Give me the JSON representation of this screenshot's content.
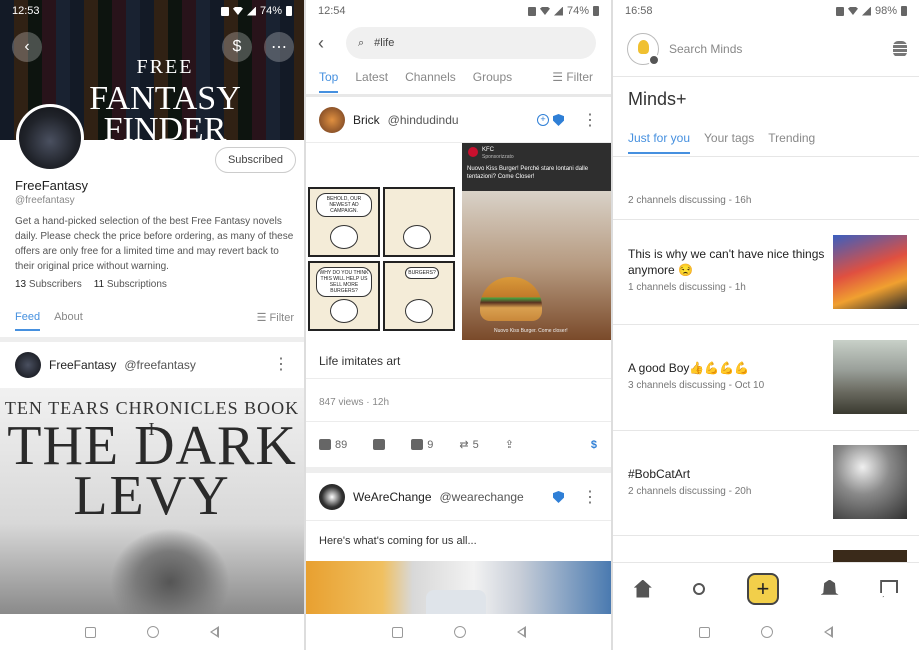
{
  "colors": {
    "accent": "#4690df",
    "verified": "#2f7fd6",
    "divider": "#eeeeee"
  },
  "phone1": {
    "status": {
      "time": "12:53",
      "battery": "74%"
    },
    "banner": {
      "line1": "FREE",
      "line2": "FANTASY",
      "line3": "FINDER"
    },
    "header_buttons": [
      "back-icon",
      "dollar-icon",
      "more-icon"
    ],
    "header_dollar": "$",
    "subscribe_label": "Subscribed",
    "channel": {
      "name": "FreeFantasy",
      "handle": "@freefantasy",
      "bio": "Get a hand-picked selection of the best Free Fantasy novels daily. Please check the price before ordering, as many of these offers are only free for a limited time and may revert back to their original price without warning.",
      "subscribers_count": "13",
      "subscribers_label": "Subscribers",
      "subscriptions_count": "11",
      "subscriptions_label": "Subscriptions"
    },
    "tabs": [
      "Feed",
      "About"
    ],
    "filter_label": "Filter",
    "post": {
      "name": "FreeFantasy",
      "handle": "@freefantasy",
      "book_line1": "TEN TEARS CHRONICLES BOOK I",
      "book_line2": "THE DARK",
      "book_line3": "LEVY"
    }
  },
  "phone2": {
    "status": {
      "time": "12:54",
      "battery": "74%"
    },
    "search_value": "#life",
    "tabs": [
      "Top",
      "Latest",
      "Channels",
      "Groups"
    ],
    "filter_label": "Filter",
    "post1": {
      "name": "Brick",
      "handle": "@hindudindu",
      "comic_texts": [
        "BEHOLD, OUR NEWEST AD CAMPAIGN.",
        "WHY DO YOU THINK THIS WILL HELP US SELL MORE BURGERS?",
        "BURGERS?"
      ],
      "ad_brand": "KFC",
      "ad_sponsored": "Sponsorizzato",
      "ad_text": "Nuovo Kiss Burger! Perché stare lontani dalle tentazioni? Come Closer!",
      "ad_footer": "Nuovo Kiss Burger. Come closer!",
      "caption": "Life imitates art",
      "meta": "847 views · 12h",
      "likes": "89",
      "comments": "9",
      "reminds": "5",
      "tip_symbol": "$"
    },
    "post2": {
      "name": "WeAreChange",
      "handle": "@wearechange",
      "text": "Here's what's coming for us all..."
    }
  },
  "phone3": {
    "status": {
      "time": "16:58",
      "battery": "98%"
    },
    "search_placeholder": "Search Minds",
    "title": "Minds+",
    "tabs": [
      "Just for you",
      "Your tags",
      "Trending"
    ],
    "items": [
      {
        "title": "",
        "sub": "2 channels discussing - 16h"
      },
      {
        "title": "This is why we can't have nice things anymore 😒",
        "sub": "1 channels discussing - 1h"
      },
      {
        "title": "A good Boy👍💪💪💪",
        "sub": "3 channels discussing - Oct 10"
      },
      {
        "title": "#BobCatArt",
        "sub": "2 channels discussing - 20h"
      }
    ],
    "compose_symbol": "+",
    "bottom_nav": [
      "home-icon",
      "search-icon",
      "compose-icon",
      "bell-icon",
      "chat-icon"
    ]
  }
}
